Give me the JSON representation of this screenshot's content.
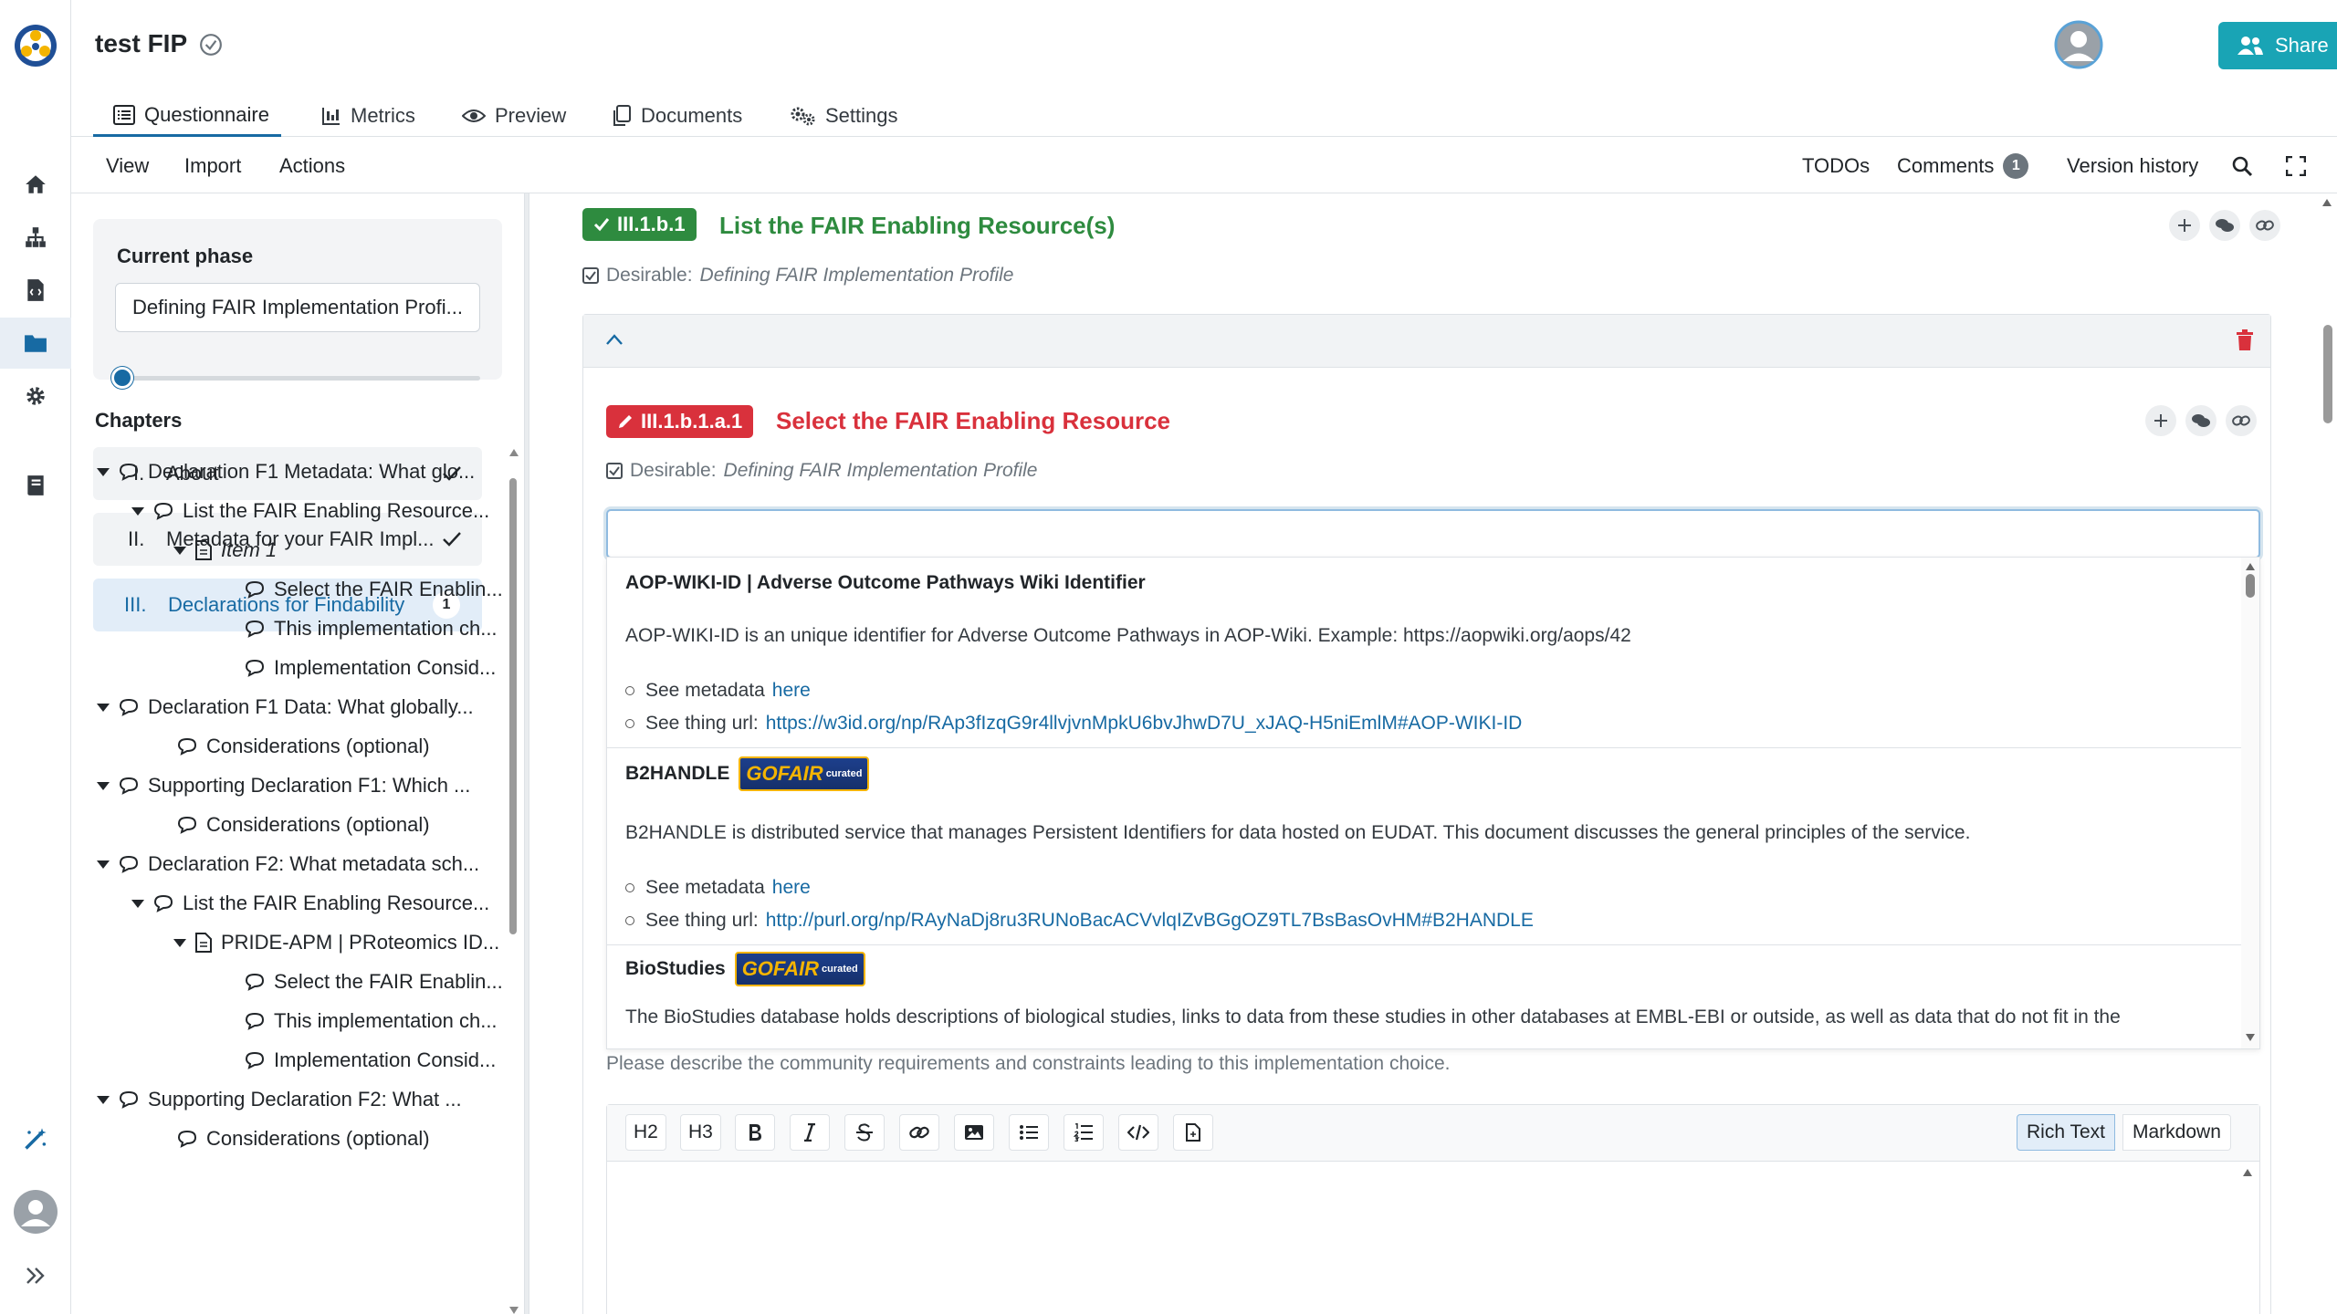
{
  "project": {
    "title": "test FIP"
  },
  "tabs": [
    {
      "label": "Questionnaire",
      "icon": "list-alt-icon"
    },
    {
      "label": "Metrics",
      "icon": "chart-icon"
    },
    {
      "label": "Preview",
      "icon": "eye-icon"
    },
    {
      "label": "Documents",
      "icon": "copy-icon"
    },
    {
      "label": "Settings",
      "icon": "cogs-icon"
    }
  ],
  "share": {
    "label": "Share"
  },
  "toolbar": {
    "view": "View",
    "import": "Import",
    "actions": "Actions",
    "todos": "TODOs",
    "comments": "Comments",
    "comments_count": "1",
    "version_history": "Version history"
  },
  "phase": {
    "label": "Current phase",
    "value": "Defining FAIR Implementation Profi..."
  },
  "chapters": {
    "label": "Chapters",
    "items": [
      {
        "num": "I.",
        "title": "About"
      },
      {
        "num": "II.",
        "title": "Metadata for your FAIR Impl..."
      },
      {
        "num": "III.",
        "title": "Declarations for Findability",
        "badge": "1"
      }
    ]
  },
  "tree": [
    "Declaration F1 Metadata: What glo...",
    "List the FAIR Enabling Resource...",
    "Item 1",
    "Select the FAIR Enablin...",
    "This implementation ch...",
    "Implementation Consid...",
    "Declaration F1 Data: What globally...",
    "Considerations (optional)",
    "Supporting Declaration F1: Which ...",
    "Considerations (optional)",
    "Declaration F2: What metadata sch...",
    "List the FAIR Enabling Resource...",
    "PRIDE-APM | PRoteomics ID...",
    "Select the FAIR Enablin...",
    "This implementation ch...",
    "Implementation Consid...",
    "Supporting Declaration F2: What ...",
    "Considerations (optional)"
  ],
  "question_main": {
    "number": "III.1.b.1",
    "title": "List the FAIR Enabling Resource(s)",
    "desirable_label": "Desirable:",
    "desirable_phase": "Defining FAIR Implementation Profile"
  },
  "question_sub": {
    "number": "III.1.b.1.a.1",
    "title": "Select the FAIR Enabling Resource",
    "desirable_label": "Desirable:",
    "desirable_phase": "Defining FAIR Implementation Profile",
    "search_value": ""
  },
  "options": [
    {
      "title": "AOP-WIKI-ID | Adverse Outcome Pathways Wiki Identifier",
      "description": "AOP-WIKI-ID is an unique identifier for Adverse Outcome Pathways in AOP-Wiki. Example: https://aopwiki.org/aops/42",
      "metadata_prefix": "See metadata",
      "metadata_link": "here",
      "url_prefix": "See thing url:",
      "url": "https://w3id.org/np/RAp3fIzqG9r4llvjvnMpkU6bvJhwD7U_xJAQ-H5niEmlM#AOP-WIKI-ID"
    },
    {
      "title": "B2HANDLE",
      "badge": "GOFAIR",
      "description": "B2HANDLE is distributed service that manages Persistent Identifiers for data hosted on EUDAT. This document discusses the general principles of the service.",
      "metadata_prefix": "See metadata",
      "metadata_link": "here",
      "url_prefix": "See thing url:",
      "url": "http://purl.org/np/RAyNaDj8ru3RUNoBacACVvlqIZvBGgOZ9TL7BsBasOvHM#B2HANDLE"
    },
    {
      "title": "BioStudies",
      "badge": "GOFAIR",
      "description": "The BioStudies database holds descriptions of biological studies, links to data from these studies in other databases at EMBL-EBI or outside, as well as data that do not fit in the"
    }
  ],
  "gofair_badge": {
    "main": "GOFAIR",
    "sub": "curated"
  },
  "implementation_hint": "Please describe the community requirements and constraints leading to this implementation choice.",
  "editor": {
    "buttons": [
      "H2",
      "H3"
    ],
    "mode_rich": "Rich Text",
    "mode_markdown": "Markdown"
  },
  "colors": {
    "accent": "#176aa3",
    "share": "#19a4b5",
    "green": "#2e8b3f",
    "red": "#d9313c"
  }
}
